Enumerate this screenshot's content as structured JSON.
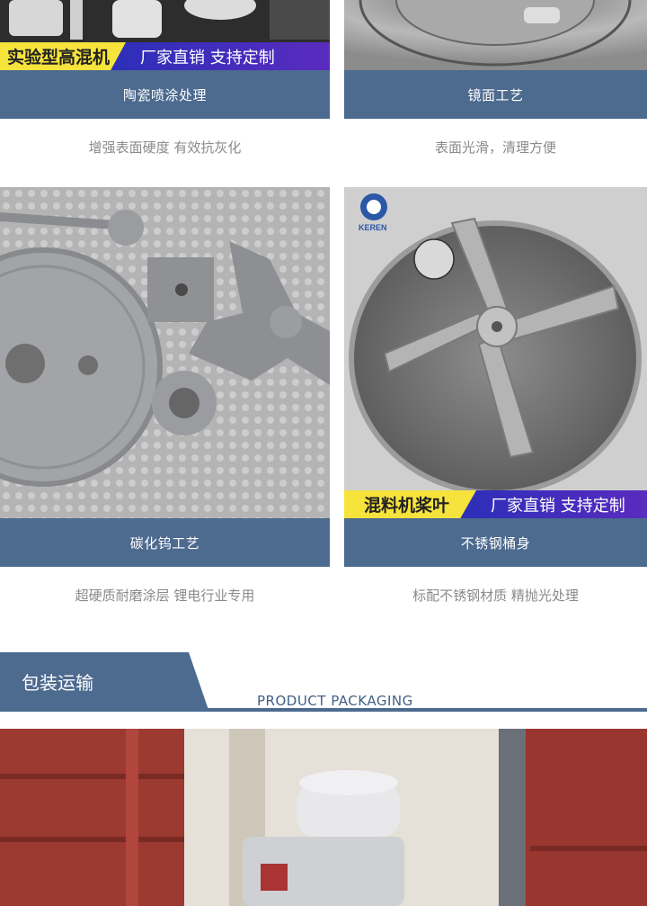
{
  "cards": [
    {
      "title": "陶瓷喷涂处理",
      "desc": "增强表面硬度 有效抗灰化",
      "banner_left": "实验型高混机",
      "banner_right": "厂家直销  支持定制"
    },
    {
      "title": "镜面工艺",
      "desc": "表面光滑，清理方便"
    },
    {
      "title": "碳化钨工艺",
      "desc": "超硬质耐磨涂层 锂电行业专用"
    },
    {
      "title": "不锈钢桶身",
      "desc": "标配不锈钢材质 精抛光处理",
      "banner_left": "混料机桨叶",
      "banner_right": "厂家直销  支持定制",
      "logo_text": "KEREN"
    }
  ],
  "section": {
    "title_cn": "包装运输",
    "title_en": "PRODUCT PACKAGING"
  },
  "colors": {
    "accent": "#4d6a8f",
    "banner_yellow": "#f6e33c",
    "banner_purple": "#3b2fbf"
  }
}
